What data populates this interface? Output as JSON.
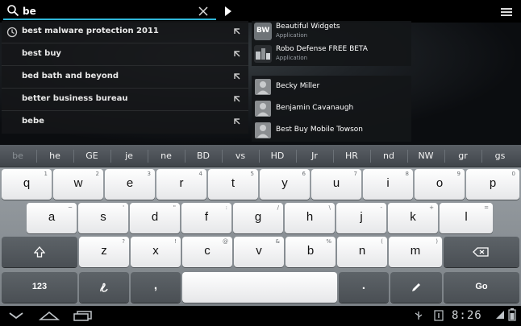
{
  "search": {
    "query": "be"
  },
  "suggestions": [
    {
      "text": "best malware protection 2011",
      "history": true
    },
    {
      "text": "best buy",
      "history": false
    },
    {
      "text": "bed bath and beyond",
      "history": false
    },
    {
      "text": "better business bureau",
      "history": false
    },
    {
      "text": "bebe",
      "history": false
    }
  ],
  "apps": [
    {
      "title": "Beautiful Widgets",
      "subtitle": "Application",
      "icon_text": "BW",
      "color": "#6f7478"
    },
    {
      "title": "Robo Defense FREE BETA",
      "subtitle": "Application",
      "icon_text": "",
      "color": "#4a4e52"
    }
  ],
  "contacts": [
    {
      "name": "Becky Miller"
    },
    {
      "name": "Benjamin Cavanaugh"
    },
    {
      "name": "Best Buy Mobile Towson"
    }
  ],
  "candidates": [
    "be",
    "he",
    "GE",
    "je",
    "ne",
    "BD",
    "vs",
    "HD",
    "Jr",
    "HR",
    "nd",
    "NW",
    "gr",
    "gs"
  ],
  "keyboard": {
    "row1": [
      {
        "k": "q",
        "h": "1"
      },
      {
        "k": "w",
        "h": "2"
      },
      {
        "k": "e",
        "h": "3"
      },
      {
        "k": "r",
        "h": "4"
      },
      {
        "k": "t",
        "h": "5"
      },
      {
        "k": "y",
        "h": "6"
      },
      {
        "k": "u",
        "h": "7"
      },
      {
        "k": "i",
        "h": "8"
      },
      {
        "k": "o",
        "h": "9"
      },
      {
        "k": "p",
        "h": "0"
      }
    ],
    "row2": [
      {
        "k": "a",
        "h": "~"
      },
      {
        "k": "s",
        "h": "'"
      },
      {
        "k": "d",
        "h": "\""
      },
      {
        "k": "f",
        "h": ":"
      },
      {
        "k": "g",
        "h": "/"
      },
      {
        "k": "h",
        "h": "\\"
      },
      {
        "k": "j",
        "h": "-"
      },
      {
        "k": "k",
        "h": "+"
      },
      {
        "k": "l",
        "h": "="
      }
    ],
    "row3": [
      {
        "k": "z",
        "h": "?"
      },
      {
        "k": "x",
        "h": "!"
      },
      {
        "k": "c",
        "h": "@"
      },
      {
        "k": "v",
        "h": "&"
      },
      {
        "k": "b",
        "h": "%"
      },
      {
        "k": "n",
        "h": "("
      },
      {
        "k": "m",
        "h": ")"
      }
    ],
    "symbols_label": "123",
    "comma_label": ",",
    "period_label": ".",
    "go_label": "Go"
  },
  "status": {
    "time": "8:26"
  }
}
